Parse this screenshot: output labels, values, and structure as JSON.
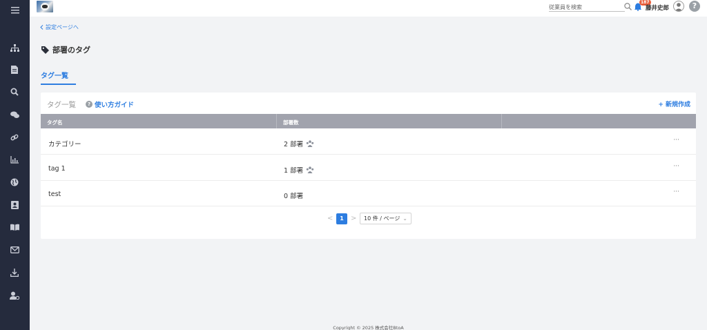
{
  "sidebar": {
    "menu_icon": "hamburger-icon",
    "items": [
      {
        "icon": "org-chart-icon"
      },
      {
        "icon": "document-icon"
      },
      {
        "icon": "search-icon"
      },
      {
        "icon": "chat-icon"
      },
      {
        "icon": "link-icon"
      },
      {
        "icon": "analytics-icon"
      },
      {
        "icon": "globe-icon"
      },
      {
        "icon": "contact-book-icon"
      },
      {
        "icon": "book-icon"
      },
      {
        "icon": "mail-icon"
      },
      {
        "icon": "download-icon"
      },
      {
        "icon": "user-settings-icon"
      }
    ]
  },
  "topbar": {
    "search_placeholder": "従業員を検索",
    "notification_count": "187",
    "username": "藤井史郎",
    "help_label": "?"
  },
  "breadcrumb": {
    "back_label": "設定ページへ"
  },
  "page": {
    "title": "部署のタグ"
  },
  "tabs": [
    {
      "label": "タグ一覧",
      "active": true
    }
  ],
  "card": {
    "title": "タグ一覧",
    "guide_label": "使い方ガイド",
    "new_label": "+ 新規作成"
  },
  "table": {
    "columns": [
      "タグ名",
      "部署数"
    ],
    "rows": [
      {
        "name": "カテゴリー",
        "count": "2 部署",
        "has_icon": true,
        "more": "···"
      },
      {
        "name": "tag 1",
        "count": "1 部署",
        "has_icon": true,
        "more": "···"
      },
      {
        "name": "test",
        "count": "0 部署",
        "has_icon": false,
        "more": "···"
      }
    ]
  },
  "pagination": {
    "current": "1",
    "page_size": "10 件 / ページ",
    "prev": "<",
    "next": ">"
  },
  "footer": {
    "copyright": "Copyright © 2025 株式会社BtoA"
  },
  "colors": {
    "accent": "#2d7de0",
    "sidebar": "#252b3d",
    "table_header": "#a1a3ad",
    "badge": "#e85d3a"
  }
}
